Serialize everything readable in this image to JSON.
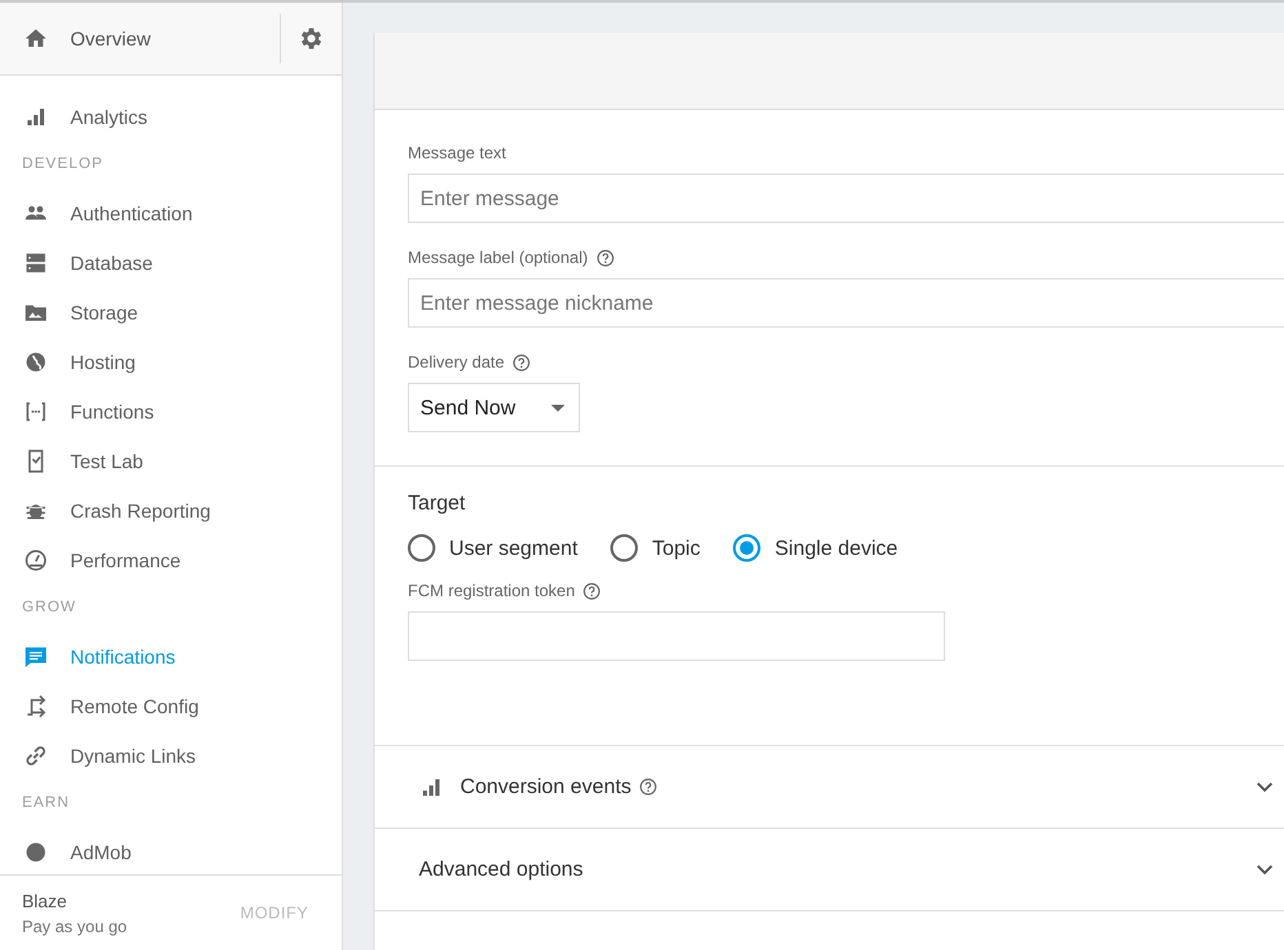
{
  "sidebar": {
    "overview": {
      "label": "Overview"
    },
    "sections": [
      {
        "items": [
          {
            "label": "Analytics",
            "selected": false
          }
        ]
      },
      {
        "heading": "DEVELOP",
        "items": [
          {
            "label": "Authentication",
            "selected": false
          },
          {
            "label": "Database",
            "selected": false
          },
          {
            "label": "Storage",
            "selected": false
          },
          {
            "label": "Hosting",
            "selected": false
          },
          {
            "label": "Functions",
            "selected": false
          },
          {
            "label": "Test Lab",
            "selected": false
          },
          {
            "label": "Crash Reporting",
            "selected": false
          },
          {
            "label": "Performance",
            "selected": false
          }
        ]
      },
      {
        "heading": "GROW",
        "items": [
          {
            "label": "Notifications",
            "selected": true
          },
          {
            "label": "Remote Config",
            "selected": false
          },
          {
            "label": "Dynamic Links",
            "selected": false
          }
        ]
      },
      {
        "heading": "EARN",
        "items": [
          {
            "label": "AdMob",
            "selected": false
          }
        ]
      }
    ],
    "plan": {
      "name": "Blaze",
      "description": "Pay as you go",
      "action": "MODIFY"
    }
  },
  "form": {
    "message_text": {
      "label": "Message text",
      "placeholder": "Enter message"
    },
    "message_label": {
      "label": "Message label (optional)",
      "placeholder": "Enter message nickname"
    },
    "delivery_date": {
      "label": "Delivery date",
      "value": "Send Now"
    },
    "target": {
      "title": "Target",
      "options": [
        {
          "label": "User segment",
          "selected": false
        },
        {
          "label": "Topic",
          "selected": false
        },
        {
          "label": "Single device",
          "selected": true
        }
      ],
      "token": {
        "label": "FCM registration token"
      }
    },
    "sections": [
      {
        "title": "Conversion events"
      },
      {
        "title": "Advanced options"
      }
    ]
  }
}
